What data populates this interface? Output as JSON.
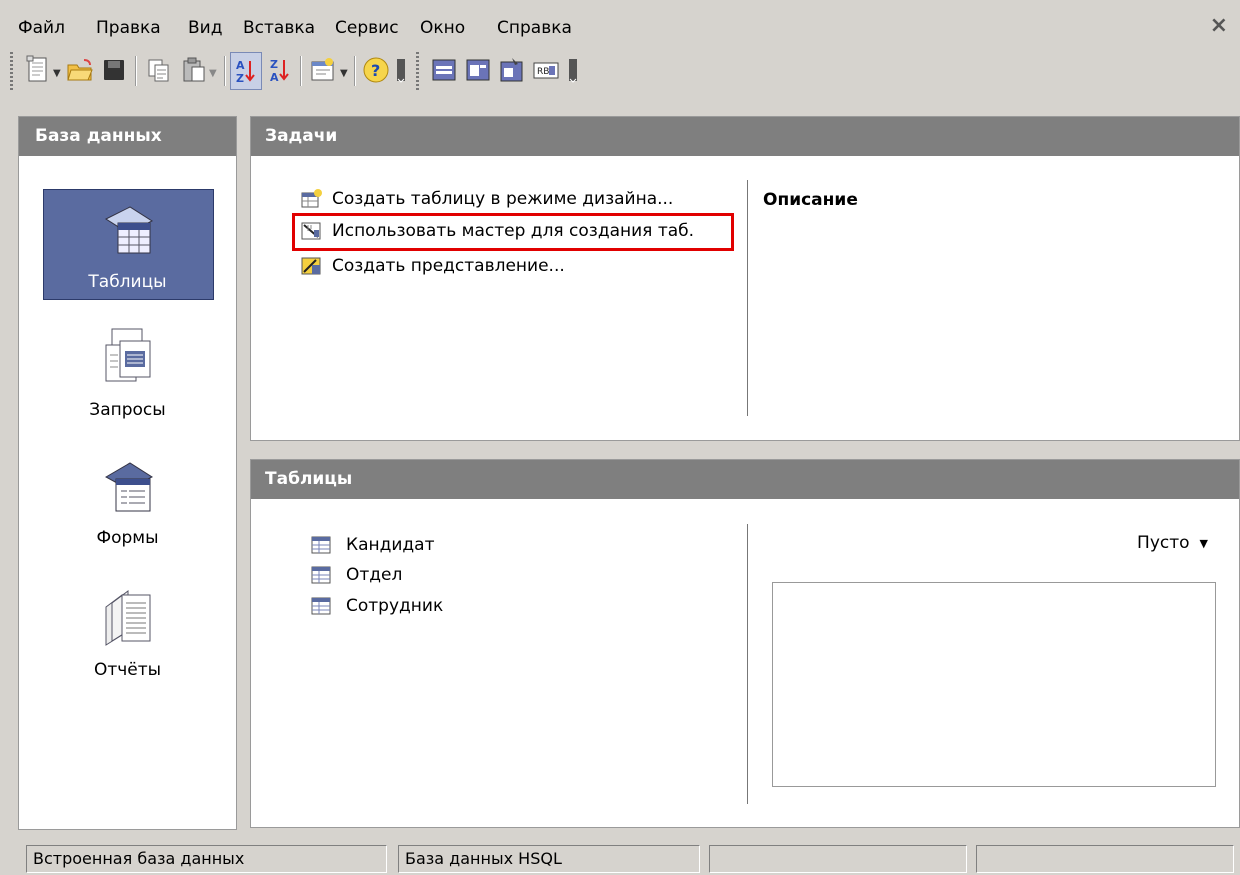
{
  "menu": [
    {
      "label": "Файл"
    },
    {
      "label": "Правка"
    },
    {
      "label": "Вид"
    },
    {
      "label": "Вставка"
    },
    {
      "label": "Сервис"
    },
    {
      "label": "Окно"
    },
    {
      "label": "Справка"
    }
  ],
  "window": {
    "close_glyph": "×"
  },
  "toolbar": {
    "buttons": [
      {
        "icon": "new-document-icon"
      },
      {
        "icon": "open-folder-icon"
      },
      {
        "icon": "save-icon"
      },
      {
        "icon": "copy-icon"
      },
      {
        "icon": "paste-icon"
      },
      {
        "icon": "sort-ascending-icon"
      },
      {
        "icon": "sort-descending-icon"
      },
      {
        "icon": "form-design-icon"
      },
      {
        "icon": "help-icon"
      },
      {
        "icon": "table-icon"
      },
      {
        "icon": "query-icon"
      },
      {
        "icon": "form-icon"
      },
      {
        "icon": "report-icon"
      }
    ]
  },
  "left": {
    "title": "База данных",
    "items": [
      {
        "label": "Таблицы",
        "icon": "tables-icon",
        "selected": true
      },
      {
        "label": "Запросы",
        "icon": "queries-icon"
      },
      {
        "label": "Формы",
        "icon": "forms-icon"
      },
      {
        "label": "Отчёты",
        "icon": "reports-icon"
      }
    ]
  },
  "tasks": {
    "title": "Задачи",
    "items": [
      {
        "label": "Создать таблицу в режиме дизайна...",
        "icon": "design-table-icon"
      },
      {
        "label": "Использовать мастер для создания таб.",
        "icon": "wizard-icon",
        "highlighted": true
      },
      {
        "label": "Создать представление...",
        "icon": "create-view-icon"
      }
    ],
    "description_title": "Описание"
  },
  "tables": {
    "title": "Таблицы",
    "items": [
      {
        "label": "Кандидат"
      },
      {
        "label": "Отдел"
      },
      {
        "label": "Сотрудник"
      }
    ],
    "preview_option": "Пусто"
  },
  "status": [
    "Встроенная база данных",
    "База данных HSQL",
    "",
    ""
  ],
  "colors": {
    "header_bg": "#7f7f7f",
    "selected_nav_bg": "#5a6ba0",
    "highlight_border": "#e10000",
    "window_bg": "#d6d3ce"
  }
}
